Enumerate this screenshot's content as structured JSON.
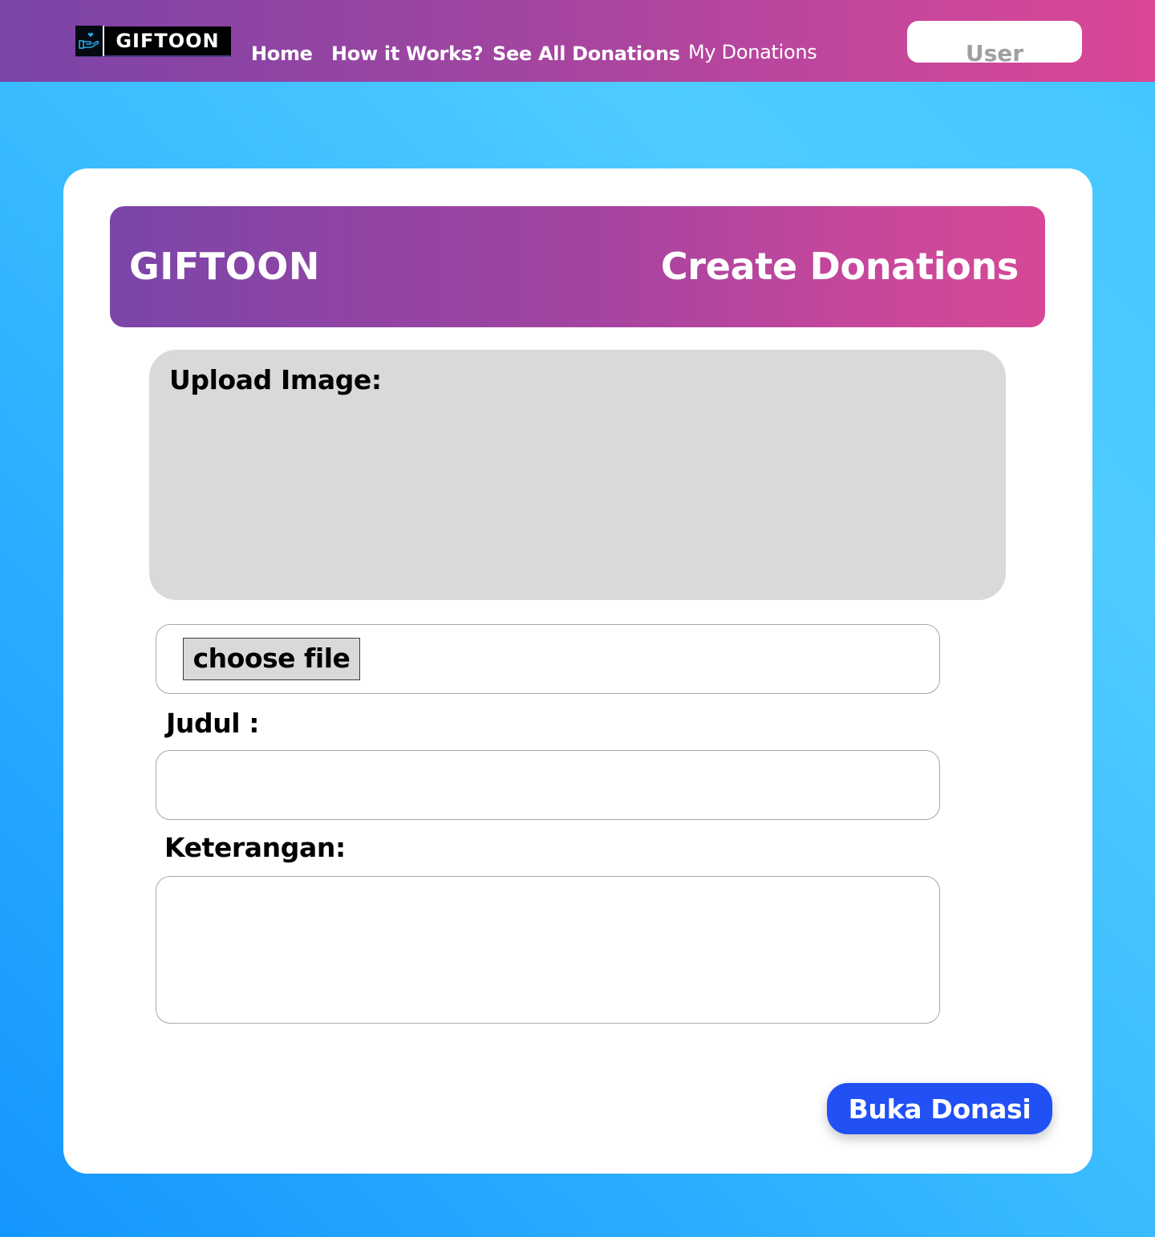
{
  "navbar": {
    "logo": {
      "text": "GIFTOON",
      "icon": "hand-heart-icon"
    },
    "links": [
      {
        "label": "Home"
      },
      {
        "label": "How it Works?"
      },
      {
        "label": "See All Donations"
      },
      {
        "label": "My Donations"
      }
    ],
    "user_button": {
      "label": "User"
    }
  },
  "card": {
    "header": {
      "brand": "GIFTOON",
      "title": "Create Donations"
    },
    "upload": {
      "label": "Upload Image:"
    },
    "file_input": {
      "button_label": "choose file"
    },
    "judul": {
      "label": "Judul :",
      "value": ""
    },
    "keterangan": {
      "label": "Keterangan:",
      "value": ""
    },
    "submit": {
      "label": "Buka Donasi"
    }
  },
  "colors": {
    "navbar_gradient_start": "#7a44a8",
    "navbar_gradient_end": "#da4796",
    "background_gradient_start": "#1496ff",
    "background_gradient_end": "#4fcbff",
    "submit_button": "#2151f5",
    "upload_box": "#d9d9d9"
  }
}
